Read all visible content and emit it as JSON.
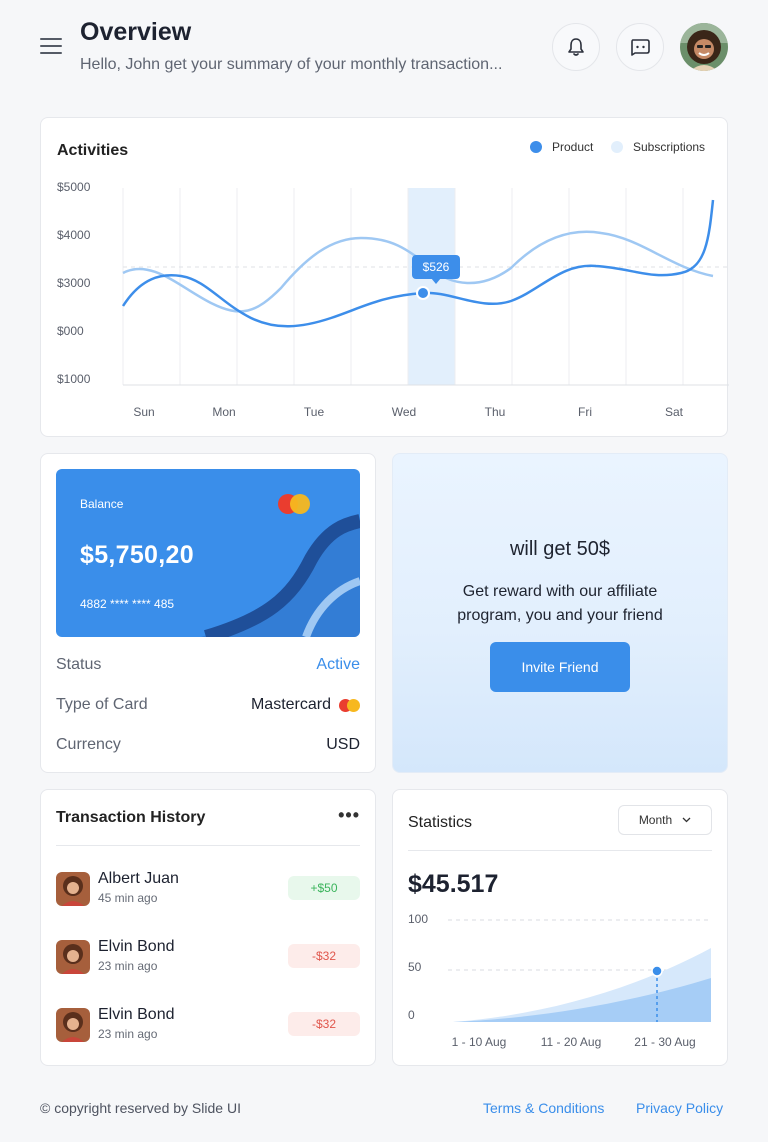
{
  "header": {
    "title": "Overview",
    "subtitle": "Hello, John get your summary of your monthly transaction..."
  },
  "activities": {
    "title": "Activities",
    "legend": [
      {
        "label": "Product",
        "color": "#3d8eea"
      },
      {
        "label": "Subscriptions",
        "color": "#e2effc"
      }
    ],
    "y_ticks": [
      "$5000",
      "$4000",
      "$3000",
      "$000",
      "$1000"
    ],
    "x_ticks": [
      "Sun",
      "Mon",
      "Tue",
      "Wed",
      "Thu",
      "Fri",
      "Sat"
    ],
    "tooltip": "$526",
    "highlighted_day": "Wed"
  },
  "balance": {
    "label": "Balance",
    "amount": "$5,750,20",
    "card_number": "4882 **** **** 485",
    "rows": [
      {
        "key": "Status",
        "value": "Active"
      },
      {
        "key": "Type of Card",
        "value": "Mastercard"
      },
      {
        "key": "Currency",
        "value": "USD"
      }
    ]
  },
  "promo": {
    "headline": "will get 50$",
    "text": "Get reward with our affiliate program, you and your friend",
    "button": "Invite Friend"
  },
  "transactions": {
    "title": "Transaction History",
    "more": "•••",
    "items": [
      {
        "name": "Albert Juan",
        "time": "45 min ago",
        "amount": "+$50",
        "type": "pos"
      },
      {
        "name": "Elvin Bond",
        "time": "23 min ago",
        "amount": "-$32",
        "type": "neg"
      },
      {
        "name": "Elvin Bond",
        "time": "23 min ago",
        "amount": "-$32",
        "type": "neg"
      }
    ]
  },
  "statistics": {
    "title": "Statistics",
    "period": "Month",
    "amount": "$45.517",
    "y_ticks": [
      "100",
      "50",
      "0"
    ],
    "x_ticks": [
      "1 - 10 Aug",
      "11 - 20 Aug",
      "21 - 30 Aug"
    ]
  },
  "footer": {
    "copyright": "© copyright reserved by Slide UI",
    "terms": "Terms & Conditions",
    "privacy": "Privacy Policy"
  },
  "colors": {
    "accent": "#3a8eea",
    "positive": "#3bb45c",
    "negative": "#e0564c"
  }
}
